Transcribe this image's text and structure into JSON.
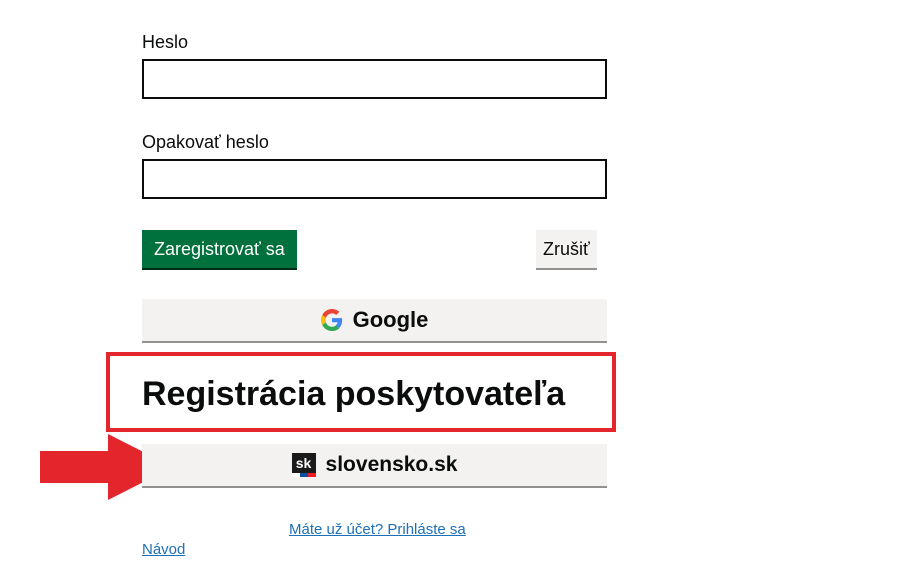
{
  "form": {
    "password_label": "Heslo",
    "password_value": "",
    "repeat_password_label": "Opakovať heslo",
    "repeat_password_value": "",
    "register_button": "Zaregistrovať sa",
    "cancel_button": "Zrušiť"
  },
  "google_button": {
    "label": "Google",
    "icon": "google-g-icon"
  },
  "provider_heading": "Registrácia poskytovateľa",
  "slovensko_button": {
    "label": "slovensko.sk",
    "icon": "slovensko-sk-logo",
    "logo_text": "sk"
  },
  "links": {
    "login": "Máte už účet? Prihláste sa",
    "guide": "Návod"
  },
  "annotations": {
    "highlight_color": "#e3262b",
    "arrow_color": "#e3262b"
  },
  "colors": {
    "primary": "#00703c",
    "secondary_bg": "#f3f2f1",
    "link": "#1d70b8"
  }
}
